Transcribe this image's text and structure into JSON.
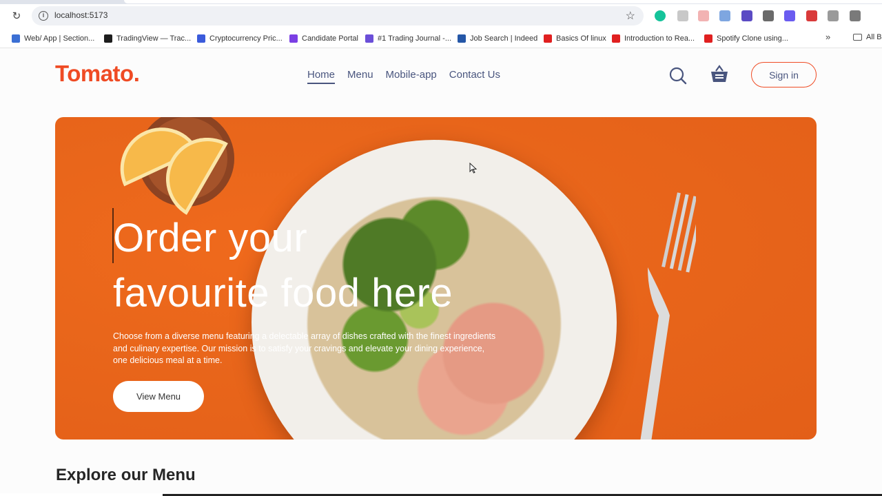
{
  "browser": {
    "url": "localhost:5173",
    "bookmarks": [
      {
        "label": "Web/ App | Section...",
        "color": "#3b6fd4"
      },
      {
        "label": "TradingView — Trac...",
        "color": "#1e1e1e"
      },
      {
        "label": "Cryptocurrency Pric...",
        "color": "#3b5bdb"
      },
      {
        "label": "Candidate Portal",
        "color": "#7b3fe4"
      },
      {
        "label": "#1 Trading Journal -...",
        "color": "#6b4fd8"
      },
      {
        "label": "Job Search | Indeed",
        "color": "#2557a7"
      },
      {
        "label": "Basics Of linux",
        "color": "#e02020"
      },
      {
        "label": "Introduction to Rea...",
        "color": "#e02020"
      },
      {
        "label": "Spotify Clone using...",
        "color": "#e02020"
      }
    ],
    "more_bookmarks": "»",
    "all_bookmarks": "All B"
  },
  "site": {
    "logo": "Tomato.",
    "nav": [
      "Home",
      "Menu",
      "Mobile-app",
      "Contact Us"
    ],
    "active_nav": "Home",
    "sign_in": "Sign in",
    "brand_color": "#ef4b24"
  },
  "hero": {
    "title_line1": "Order your",
    "title_line2": "favourite food here",
    "description": "Choose from a diverse menu featuring a delectable array of dishes crafted with the finest ingredients and culinary expertise. Our mission is to satisfy your cravings and elevate your dining experience, one delicious meal at a time.",
    "button": "View Menu"
  },
  "explore": {
    "title": "Explore our Menu"
  }
}
